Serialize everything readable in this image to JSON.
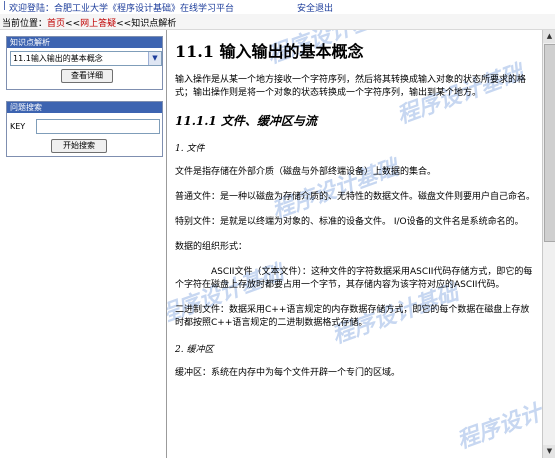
{
  "topbar": {
    "pipe": "|",
    "welcome": "欢迎登陆：合肥工业大学《程序设计基础》在线学习平台",
    "logout": "安全退出"
  },
  "breadcrumb": {
    "prefix": "当前位置：",
    "home": "首页",
    "sep1": "<<",
    "online": "网上答疑",
    "sep2": "<<",
    "current": "知识点解析"
  },
  "sidebar": {
    "knowledge": {
      "header": "知识点解析",
      "selected": "11.1输入输出的基本概念",
      "button": "查看详细"
    },
    "search": {
      "header": "问题搜索",
      "key_label": "KEY",
      "key_value": "",
      "button": "开始搜索"
    }
  },
  "watermark": "程序设计基础",
  "article": {
    "title": "11.1 输入输出的基本概念",
    "intro": "输入操作是从某一个地方接收一个字符序列，然后将其转换成输入对象的状态所要求的格式；输出操作则是将一个对象的状态转换成一个字符序列，输出到某个地方。",
    "section": "11.1.1 文件、缓冲区与流",
    "sub1": "1. 文件",
    "p1": "文件是指存储在外部介质（磁盘与外部终端设备）上数据的集合。",
    "p2": "普通文件：是一种以磁盘为存储介质的、无特性的数据文件。磁盘文件则要用户自己命名。",
    "p3": "特别文件：是就是以终端为对象的、标准的设备文件。 I/O设备的文件名是系统命名的。",
    "p4": "数据的组织形式：",
    "p5": "ASCII文件（文本文件）：这种文件的字符数据采用ASCII代码存储方式，即它的每个字符在磁盘上存放时都要占用一个字节，其存储内容为该字符对应的ASCII代码。",
    "p6": "二进制文件：数据采用C++语言规定的内存数据存储方式，即它的每个数据在磁盘上存放时都按照C++语言规定的二进制数据格式存储。",
    "sub2": "2. 缓冲区",
    "p7": "缓冲区：系统在内存中为每个文件开辟一个专门的区域。"
  },
  "icons": {
    "dropdown": "chevron-down-icon",
    "scroll_up": "arrow-up-icon",
    "scroll_down": "arrow-down-icon"
  }
}
